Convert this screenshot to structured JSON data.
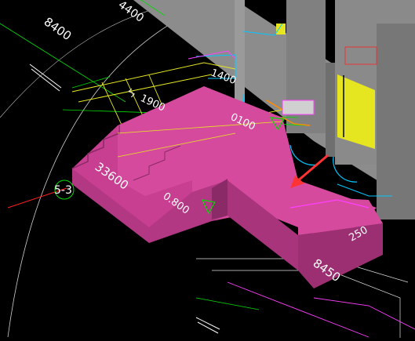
{
  "viewport": {
    "labels": {
      "dim_8400_top": "8400",
      "dim_4400": "4400",
      "dim_1400": "1400",
      "dim_1900": "1900",
      "dim_0100": "0100",
      "dim_33600": "33600",
      "grid_axis": "5-3",
      "level_0800": "0.800",
      "dim_250": "250",
      "dim_8450": "8450",
      "dim_z": "ㄣ"
    },
    "colors": {
      "background": "#000000",
      "stair_top": "#d64a9e",
      "stair_front": "#b23883",
      "stair_side": "#9c2f72",
      "wall_gray": "#8c8c8c",
      "wall_dark": "#6f6f6f",
      "accent_yellow": "#e6e620",
      "cad_green": "#00dd00",
      "cad_cyan": "#00c8ff",
      "cad_magenta": "#ff40ff",
      "cad_red": "#ff2020",
      "cad_orange": "#ff8c00",
      "arrow_red": "#ff3333"
    }
  }
}
